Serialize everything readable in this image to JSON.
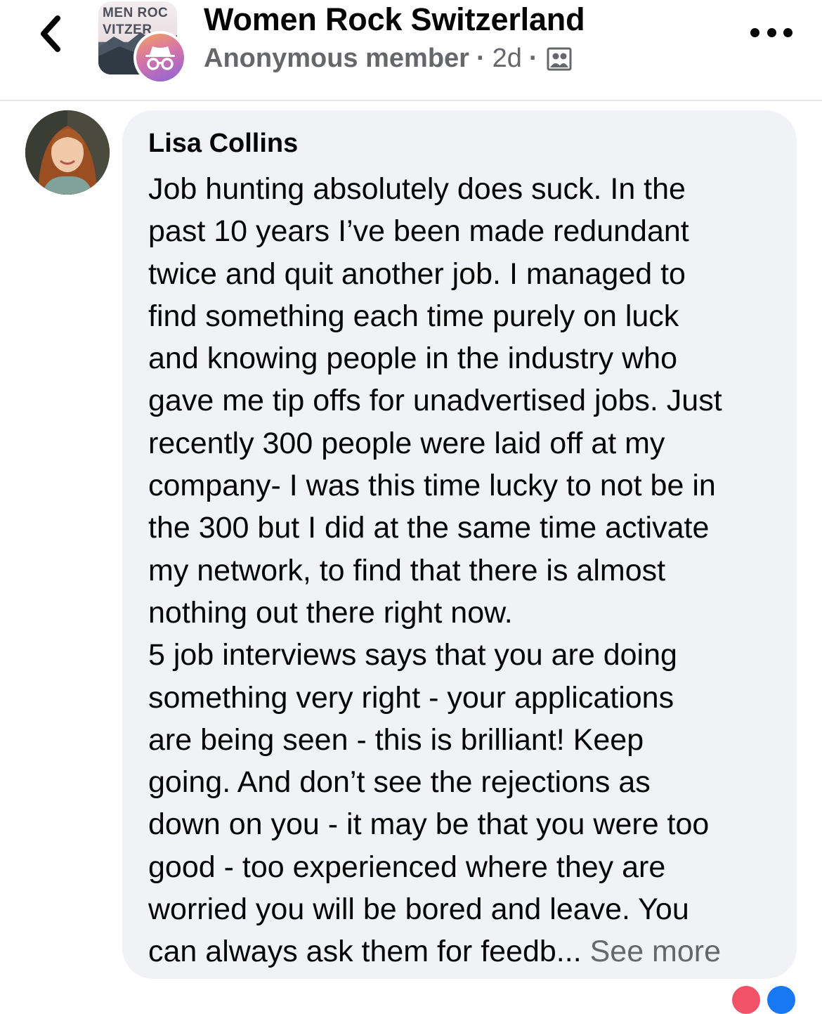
{
  "header": {
    "group_name": "Women Rock Switzerland",
    "author": "Anonymous member",
    "separator": "·",
    "time": "2d",
    "group_avatar_text_line1": "MEN ROC",
    "group_avatar_text_line2": "VITZER",
    "back_icon": "chevron-left-icon",
    "more_icon": "more-horizontal-icon",
    "audience_icon": "group-members-icon"
  },
  "comment": {
    "author": "Lisa Collins",
    "lines": [
      "Job hunting absolutely does suck. In the",
      "past 10 years I’ve been made redundant",
      "twice and quit another job. I managed to",
      "find something each time purely on luck",
      "and knowing people in the industry who",
      "gave me tip offs for unadvertised jobs. Just",
      "recently 300 people were laid off at my",
      "company- I was this time lucky to not be in",
      "the 300 but I did at the same time activate",
      "my network, to find that there is almost",
      "nothing out there right now.",
      "5 job interviews says that you are doing",
      "something very right - your applications",
      "are being seen - this is brilliant! Keep",
      "going. And don’t see the rejections as",
      "down on you - it may be that you were too",
      "good - too experienced where they are",
      "worried you will be bored and leave. You",
      "can always ask them for feedb..."
    ],
    "see_more": "See more"
  },
  "colors": {
    "bubble_bg": "#f0f2f5",
    "secondary_text": "#65676b",
    "primary_text": "#050505"
  }
}
